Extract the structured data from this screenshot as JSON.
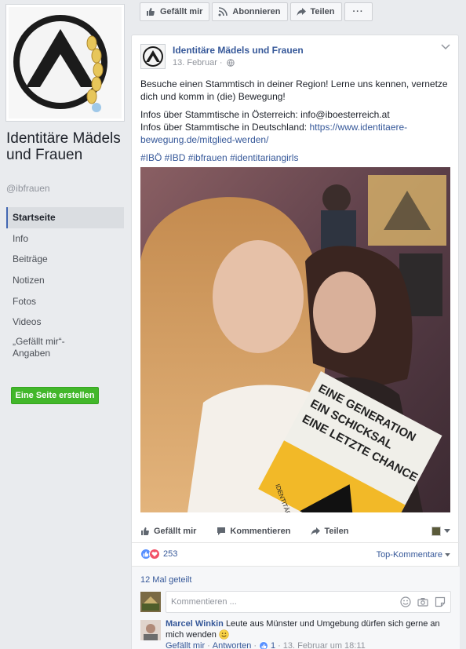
{
  "page": {
    "name": "Identitäre Mädels und Frauen",
    "handle": "@ibfrauen",
    "create_page_label": "Eine Seite erstellen"
  },
  "nav": {
    "items": [
      {
        "label": "Startseite",
        "active": true
      },
      {
        "label": "Info"
      },
      {
        "label": "Beiträge"
      },
      {
        "label": "Notizen"
      },
      {
        "label": "Fotos"
      },
      {
        "label": "Videos"
      },
      {
        "label": "„Gefällt mir“-Angaben"
      }
    ]
  },
  "actionbar": {
    "like": "Gefällt mir",
    "follow": "Abonnieren",
    "share": "Teilen",
    "more": "···"
  },
  "post": {
    "author": "Identitäre Mädels und Frauen",
    "date": "13. Februar ·",
    "text1": "Besuche einen Stammtisch in deiner Region! Lerne uns kennen, vernetze dich und komm in (die) Bewegung!",
    "text2a": "Infos über Stammtische in Österreich: info@iboesterreich.at",
    "text2b": "Infos über Stammtische in Deutschland: ",
    "text2b_link": "https://www.identitaere-bewegung.de/mitglied-werden/",
    "hashtags": "#IBÖ #IBD #ibfrauen #identitariangirls",
    "photo_text": {
      "line1": "EINE GENERATION",
      "line2": "EIN SCHICKSAL",
      "line3": "EINE LETZTE CHANCE",
      "small": "IDENTITÄRE"
    },
    "actions": {
      "like": "Gefällt mir",
      "comment": "Kommentieren",
      "share": "Teilen"
    },
    "reaction_count": "253",
    "top_comments": "Top-Kommentare",
    "shares": "12 Mal geteilt",
    "comment_placeholder": "Kommentieren ..."
  },
  "comment": {
    "author": "Marcel Winkin",
    "text": "Leute aus Münster und Umgebung dürfen sich gerne an mich wenden",
    "like": "Gefällt mir",
    "reply": "Antworten",
    "likes": "1",
    "time": "13. Februar um 18:11"
  },
  "colors": {
    "brand_blue": "#365899",
    "green": "#42b72a",
    "bg": "#e9ebee"
  }
}
